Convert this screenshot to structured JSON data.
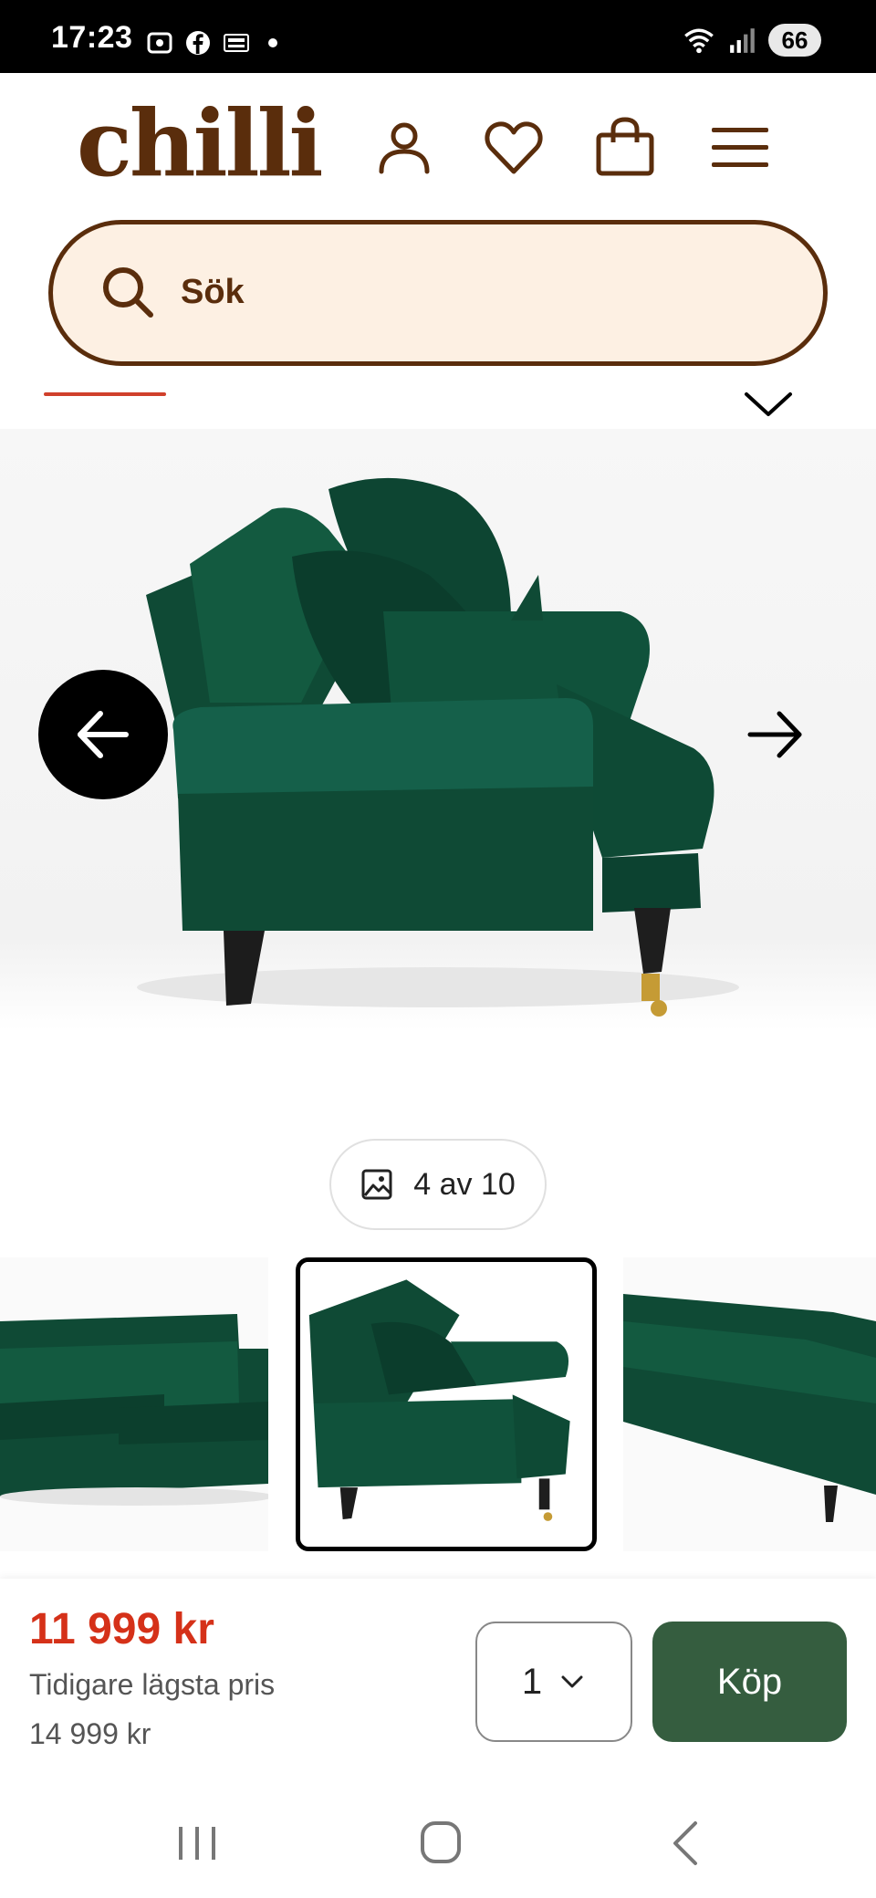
{
  "status_bar": {
    "time": "17:23",
    "battery": "66",
    "icons": [
      "screenshot-icon",
      "facebook-icon",
      "temu-icon",
      "wifi-icon",
      "signal-icon"
    ]
  },
  "header": {
    "logo_text": "chilli",
    "icons": [
      "account-icon",
      "heart-icon",
      "bag-icon",
      "menu-icon"
    ]
  },
  "search": {
    "placeholder": "Sök"
  },
  "gallery": {
    "counter_text": "4 av 10",
    "current": 4,
    "total": 10
  },
  "buy_bar": {
    "price": "11 999 kr",
    "previous_label": "Tidigare lägsta pris",
    "previous_price": "14 999 kr",
    "quantity": "1",
    "buy_label": "Köp"
  },
  "colors": {
    "brand_brown": "#5a2d0c",
    "search_bg": "#fdf0e3",
    "price_red": "#d53119",
    "buy_green": "#355d3f",
    "sofa_green": "#0f4a35"
  }
}
